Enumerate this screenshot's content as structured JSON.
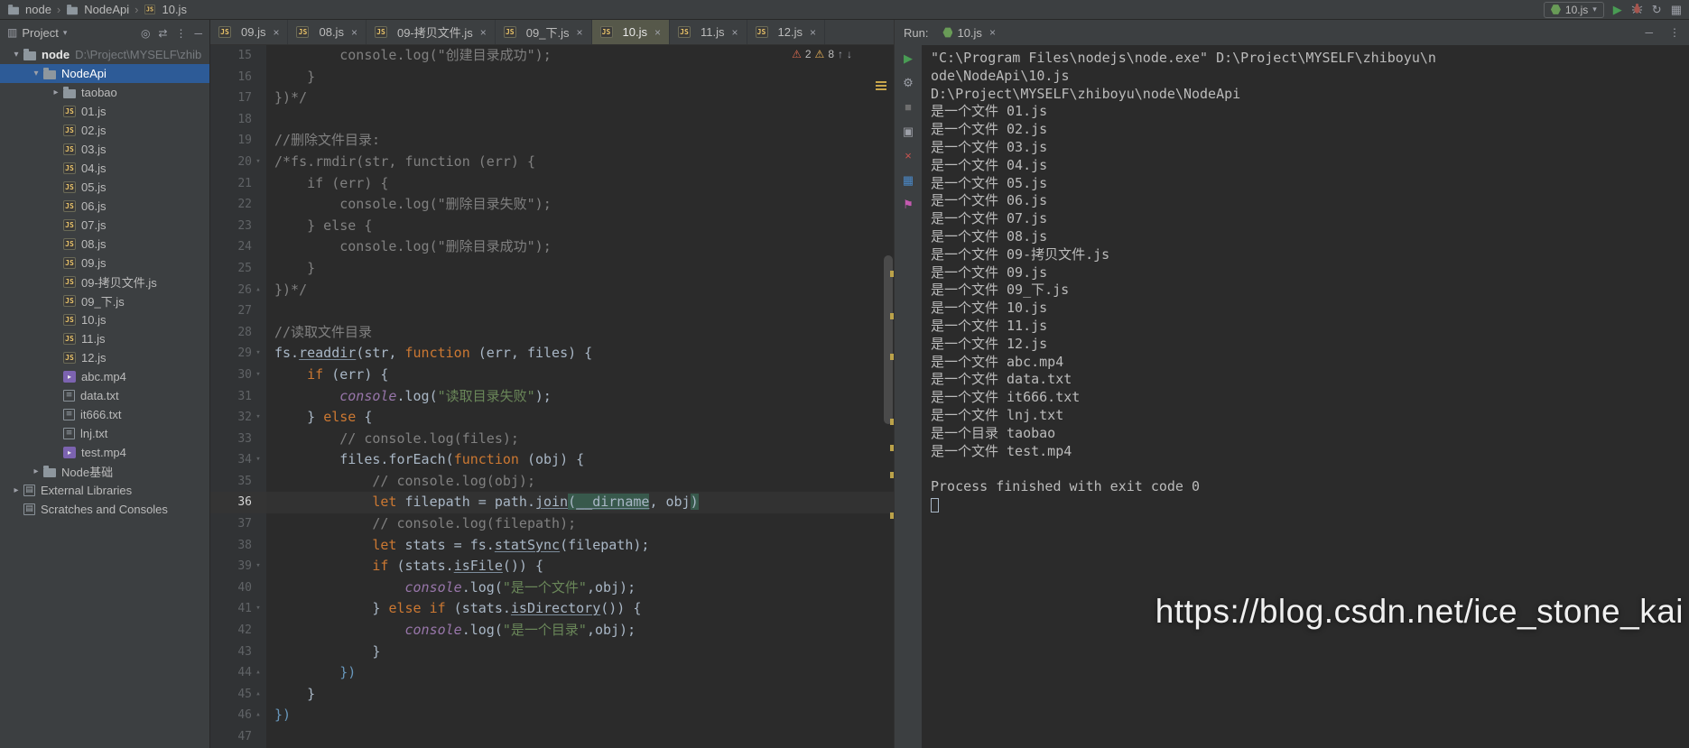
{
  "breadcrumb": {
    "items": [
      "node",
      "NodeApi",
      "10.js"
    ]
  },
  "toolbar": {
    "run_config": "10.js"
  },
  "icons": {
    "chevron_down": "▾",
    "chevron_right": "▸",
    "fold_open": "▾",
    "fold_end": "▴",
    "close": "×",
    "play": "▶",
    "coverage": "↻",
    "profiler": "▦",
    "locate_file": "◎",
    "collapse_all": "⇄",
    "panel_options": "⋮",
    "hide_panel": "─",
    "panel": "▥",
    "minimize": "─",
    "more": "⋮",
    "error_badge": "⚠",
    "warning_badge": "⚠",
    "arrow_up": "↑",
    "arrow_down": "↓"
  },
  "project_panel": {
    "title": "Project",
    "header_icons": [
      {
        "name": "locate-file",
        "glyph": "◎"
      },
      {
        "name": "collapse-all",
        "glyph": "⇄"
      },
      {
        "name": "panel-options",
        "glyph": "⋮"
      },
      {
        "name": "hide-panel",
        "glyph": "─"
      }
    ],
    "tree": [
      {
        "label": "node",
        "suffix": "D:\\Project\\MYSELF\\zhib",
        "icon": "folder",
        "level": 0,
        "chevron": "v",
        "root": true
      },
      {
        "label": "NodeApi",
        "icon": "folder",
        "level": 1,
        "chevron": "v",
        "selected": true
      },
      {
        "label": "taobao",
        "icon": "folder",
        "level": 2,
        "chevron": ">"
      },
      {
        "label": "01.js",
        "icon": "js",
        "level": 2
      },
      {
        "label": "02.js",
        "icon": "js",
        "level": 2
      },
      {
        "label": "03.js",
        "icon": "js",
        "level": 2
      },
      {
        "label": "04.js",
        "icon": "js",
        "level": 2
      },
      {
        "label": "05.js",
        "icon": "js",
        "level": 2
      },
      {
        "label": "06.js",
        "icon": "js",
        "level": 2
      },
      {
        "label": "07.js",
        "icon": "js",
        "level": 2
      },
      {
        "label": "08.js",
        "icon": "js",
        "level": 2
      },
      {
        "label": "09.js",
        "icon": "js",
        "level": 2
      },
      {
        "label": "09-拷贝文件.js",
        "icon": "js",
        "level": 2
      },
      {
        "label": "09_下.js",
        "icon": "js",
        "level": 2
      },
      {
        "label": "10.js",
        "icon": "js",
        "level": 2
      },
      {
        "label": "11.js",
        "icon": "js",
        "level": 2
      },
      {
        "label": "12.js",
        "icon": "js",
        "level": 2
      },
      {
        "label": "abc.mp4",
        "icon": "mp4",
        "level": 2
      },
      {
        "label": "data.txt",
        "icon": "txt",
        "level": 2
      },
      {
        "label": "it666.txt",
        "icon": "txt",
        "level": 2
      },
      {
        "label": "lnj.txt",
        "icon": "txt",
        "level": 2
      },
      {
        "label": "test.mp4",
        "icon": "mp4",
        "level": 2
      },
      {
        "label": "Node基础",
        "icon": "folder",
        "level": 1,
        "chevron": ">"
      },
      {
        "label": "External Libraries",
        "icon": "lib",
        "level": 0,
        "chevron": ">"
      },
      {
        "label": "Scratches and Consoles",
        "icon": "scratch",
        "level": 0
      }
    ]
  },
  "editor_tabs": [
    {
      "label": "09.js"
    },
    {
      "label": "08.js"
    },
    {
      "label": "09-拷贝文件.js"
    },
    {
      "label": "09_下.js"
    },
    {
      "label": "10.js",
      "active": true
    },
    {
      "label": "11.js"
    },
    {
      "label": "12.js"
    }
  ],
  "editor": {
    "inspections": {
      "errors": "2",
      "warnings": "8"
    },
    "lines": [
      {
        "n": 15,
        "t": [
          [
            "        console.log(\"创建目录成功\");",
            "com"
          ]
        ]
      },
      {
        "n": 16,
        "t": [
          [
            "    }",
            "com"
          ]
        ]
      },
      {
        "n": 17,
        "t": [
          [
            "})*/",
            "com"
          ]
        ]
      },
      {
        "n": 18,
        "t": []
      },
      {
        "n": 19,
        "t": [
          [
            "//删除文件目录:",
            "com"
          ]
        ]
      },
      {
        "n": 20,
        "fold": "v",
        "t": [
          [
            "/*fs.rmdir(str, function (err) {",
            "com"
          ]
        ]
      },
      {
        "n": 21,
        "t": [
          [
            "    if (err) {",
            "com"
          ]
        ]
      },
      {
        "n": 22,
        "t": [
          [
            "        console.log(\"删除目录失败\");",
            "com"
          ]
        ]
      },
      {
        "n": 23,
        "t": [
          [
            "    } else {",
            "com"
          ]
        ]
      },
      {
        "n": 24,
        "t": [
          [
            "        console.log(\"删除目录成功\");",
            "com"
          ]
        ]
      },
      {
        "n": 25,
        "t": [
          [
            "    }",
            "com"
          ]
        ]
      },
      {
        "n": 26,
        "fold": "^",
        "t": [
          [
            "})*/",
            "com"
          ]
        ]
      },
      {
        "n": 27,
        "t": []
      },
      {
        "n": 28,
        "t": [
          [
            "//读取文件目录",
            "com"
          ]
        ]
      },
      {
        "n": 29,
        "fold": "v",
        "t": [
          [
            "fs.",
            ""
          ],
          [
            "readdir",
            "und"
          ],
          [
            "(str, ",
            ""
          ],
          [
            "function",
            "kw"
          ],
          [
            " (err, files) {",
            ""
          ]
        ]
      },
      {
        "n": 30,
        "fold": "v",
        "t": [
          [
            "    ",
            ""
          ],
          [
            "if",
            "kw"
          ],
          [
            " (err) {",
            ""
          ]
        ]
      },
      {
        "n": 31,
        "t": [
          [
            "        ",
            ""
          ],
          [
            "console",
            "glb"
          ],
          [
            ".log(",
            ""
          ],
          [
            "\"读取目录失败\"",
            "str"
          ],
          [
            ");",
            ""
          ]
        ]
      },
      {
        "n": 32,
        "fold": "v",
        "t": [
          [
            "    } ",
            ""
          ],
          [
            "else",
            "kw"
          ],
          [
            " {",
            ""
          ]
        ]
      },
      {
        "n": 33,
        "t": [
          [
            "        // console.log(files);",
            "com"
          ]
        ]
      },
      {
        "n": 34,
        "fold": "v",
        "t": [
          [
            "        files.forEach(",
            ""
          ],
          [
            "function",
            "kw"
          ],
          [
            " (obj) {",
            ""
          ]
        ]
      },
      {
        "n": 35,
        "t": [
          [
            "            // console.log(obj);",
            "com"
          ]
        ]
      },
      {
        "n": 36,
        "cur": true,
        "t": [
          [
            "            ",
            ""
          ],
          [
            "let",
            "kw"
          ],
          [
            " filepath = path.",
            ""
          ],
          [
            "join",
            "und"
          ],
          [
            "(",
            "hlt"
          ],
          [
            "__dirname",
            "hlt und"
          ],
          [
            ", obj",
            ""
          ],
          [
            ")",
            "hlt"
          ]
        ]
      },
      {
        "n": 37,
        "t": [
          [
            "            // console.log(filepath);",
            "com"
          ]
        ]
      },
      {
        "n": 38,
        "t": [
          [
            "            ",
            ""
          ],
          [
            "let",
            "kw"
          ],
          [
            " stats = fs.",
            ""
          ],
          [
            "statSync",
            "und"
          ],
          [
            "(filepath);",
            ""
          ]
        ]
      },
      {
        "n": 39,
        "fold": "v",
        "t": [
          [
            "            ",
            ""
          ],
          [
            "if",
            "kw"
          ],
          [
            " (stats.",
            ""
          ],
          [
            "isFile",
            "und"
          ],
          [
            "()) {",
            ""
          ]
        ]
      },
      {
        "n": 40,
        "t": [
          [
            "                ",
            ""
          ],
          [
            "console",
            "glb"
          ],
          [
            ".log(",
            ""
          ],
          [
            "\"是一个文件\"",
            "str"
          ],
          [
            ",obj);",
            ""
          ]
        ]
      },
      {
        "n": 41,
        "fold": "v",
        "t": [
          [
            "            } ",
            ""
          ],
          [
            "else",
            "kw"
          ],
          [
            " ",
            ""
          ],
          [
            "if",
            "kw"
          ],
          [
            " (stats.",
            ""
          ],
          [
            "isDirectory",
            "und"
          ],
          [
            "()) {",
            ""
          ]
        ]
      },
      {
        "n": 42,
        "t": [
          [
            "                ",
            ""
          ],
          [
            "console",
            "glb"
          ],
          [
            ".log(",
            ""
          ],
          [
            "\"是一个目录\"",
            "str"
          ],
          [
            ",obj);",
            ""
          ]
        ]
      },
      {
        "n": 43,
        "t": [
          [
            "            }",
            ""
          ]
        ]
      },
      {
        "n": 44,
        "fold": "^",
        "t": [
          [
            "        })",
            "br"
          ]
        ]
      },
      {
        "n": 45,
        "fold": "^",
        "t": [
          [
            "    }",
            ""
          ]
        ]
      },
      {
        "n": 46,
        "fold": "^",
        "t": [
          [
            "})",
            "br"
          ]
        ]
      },
      {
        "n": 47,
        "t": []
      }
    ]
  },
  "run_panel": {
    "label": "Run:",
    "tab_label": "10.js",
    "toolbar": [
      {
        "name": "rerun",
        "glyph": "▶",
        "color": "#499C54"
      },
      {
        "name": "settings",
        "glyph": "⚙",
        "color": "#9DA0A8"
      },
      {
        "name": "stop",
        "glyph": "■",
        "color": "#6E6E6E"
      },
      {
        "name": "restore-layout",
        "glyph": "▣",
        "color": "#9DA0A8"
      },
      {
        "name": "clear-console",
        "glyph": "×",
        "color": "#C75450"
      },
      {
        "name": "layout-grid",
        "glyph": "▦",
        "color": "#4A88C7"
      },
      {
        "name": "pin",
        "glyph": "⚑",
        "color": "#C45AB0"
      }
    ],
    "output": [
      "\"C:\\Program Files\\nodejs\\node.exe\" D:\\Project\\MYSELF\\zhiboyu\\n",
      "ode\\NodeApi\\10.js",
      "D:\\Project\\MYSELF\\zhiboyu\\node\\NodeApi",
      "是一个文件 01.js",
      "是一个文件 02.js",
      "是一个文件 03.js",
      "是一个文件 04.js",
      "是一个文件 05.js",
      "是一个文件 06.js",
      "是一个文件 07.js",
      "是一个文件 08.js",
      "是一个文件 09-拷贝文件.js",
      "是一个文件 09.js",
      "是一个文件 09_下.js",
      "是一个文件 10.js",
      "是一个文件 11.js",
      "是一个文件 12.js",
      "是一个文件 abc.mp4",
      "是一个文件 data.txt",
      "是一个文件 it666.txt",
      "是一个文件 lnj.txt",
      "是一个目录 taobao",
      "是一个文件 test.mp4",
      "",
      "Process finished with exit code 0"
    ]
  },
  "watermark": {
    "text": "https://blog.csdn.net/ice_stone_kai"
  }
}
